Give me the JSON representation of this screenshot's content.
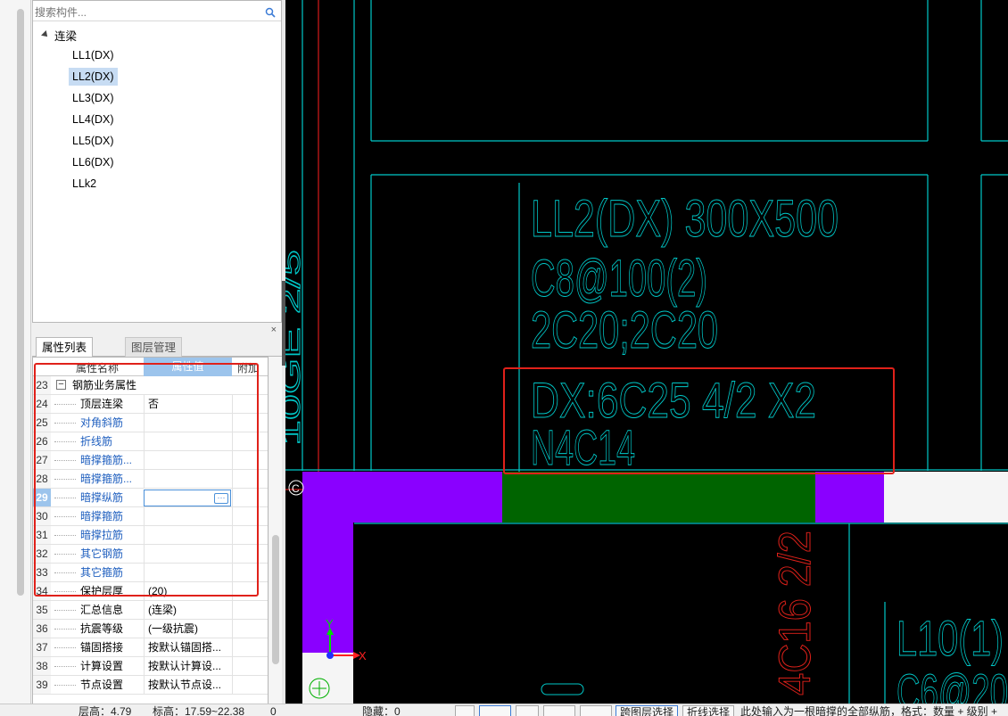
{
  "search": {
    "placeholder": "搜索构件..."
  },
  "tree": {
    "root_label": "连梁",
    "items": [
      "LL1(DX)",
      "LL2(DX)",
      "LL3(DX)",
      "LL4(DX)",
      "LL5(DX)",
      "LL6(DX)",
      "LLk2"
    ],
    "selected": "LL2(DX)"
  },
  "panel_close": "×",
  "tabs": {
    "active": "属性列表",
    "inactive": "图层管理"
  },
  "table": {
    "headers": {
      "name": "属性名称",
      "value": "属性值",
      "extra": "附加"
    },
    "group": {
      "num": "23",
      "label": "钢筋业务属性"
    },
    "rows": [
      {
        "num": "24",
        "name": "顶层连梁",
        "value": "否",
        "blue": false,
        "checkbox": true
      },
      {
        "num": "25",
        "name": "对角斜筋",
        "value": "",
        "blue": true,
        "checkbox": true
      },
      {
        "num": "26",
        "name": "折线筋",
        "value": "",
        "blue": true,
        "checkbox": true
      },
      {
        "num": "27",
        "name": "暗撑箍筋...",
        "value": "",
        "blue": true,
        "checkbox": true
      },
      {
        "num": "28",
        "name": "暗撑箍筋...",
        "value": "",
        "blue": true,
        "checkbox": true
      },
      {
        "num": "29",
        "name": "暗撑纵筋",
        "value": "",
        "blue": true,
        "checkbox": true,
        "editing": true
      },
      {
        "num": "30",
        "name": "暗撑箍筋",
        "value": "",
        "blue": true,
        "checkbox": true
      },
      {
        "num": "31",
        "name": "暗撑拉筋",
        "value": "",
        "blue": true,
        "checkbox": true
      },
      {
        "num": "32",
        "name": "其它钢筋",
        "value": "",
        "blue": true,
        "checkbox": false
      },
      {
        "num": "33",
        "name": "其它箍筋",
        "value": "",
        "blue": true,
        "checkbox": false
      },
      {
        "num": "34",
        "name": "保护层厚",
        "value": "(20)",
        "blue": false,
        "checkbox": true
      },
      {
        "num": "35",
        "name": "汇总信息",
        "value": "(连梁)",
        "blue": false,
        "checkbox": true
      },
      {
        "num": "36",
        "name": "抗震等级",
        "value": "(一级抗震)",
        "blue": false,
        "checkbox": true
      },
      {
        "num": "37",
        "name": "锚固搭接",
        "value": "按默认锚固搭...",
        "blue": false,
        "checkbox": false
      },
      {
        "num": "38",
        "name": "计算设置",
        "value": "按默认计算设...",
        "blue": false,
        "checkbox": false
      },
      {
        "num": "39",
        "name": "节点设置",
        "value": "按默认节点设...",
        "blue": false,
        "checkbox": false
      }
    ]
  },
  "cad": {
    "lines": [
      "LL2(DX) 300X500",
      "C8@100(2)",
      "2C20;2C20",
      "DX:6C25 4/2 X2",
      "N4C14"
    ],
    "vertical_label": "4C16 2/2",
    "right_label_1": "L10(1)",
    "right_label_2": "C6@20",
    "left_label": "10GE 2/5",
    "axis_label": "C",
    "axis_x": "X",
    "axis_y": "Y",
    "colors": {
      "cyan": "#00c8c8",
      "purple": "#8a00ff",
      "green": "#006400",
      "red": "#ff2020"
    }
  },
  "status": {
    "floor_height": "层高：4.79",
    "elevation": "标高：17.59~22.38",
    "zero": "0",
    "hidden": "隐藏：0",
    "cross_layer": "跨图层选择",
    "polyline_select": "折线选择",
    "hint": "此处输入为一根暗撑的全部纵筋，格式：数量 + 级别 +"
  }
}
